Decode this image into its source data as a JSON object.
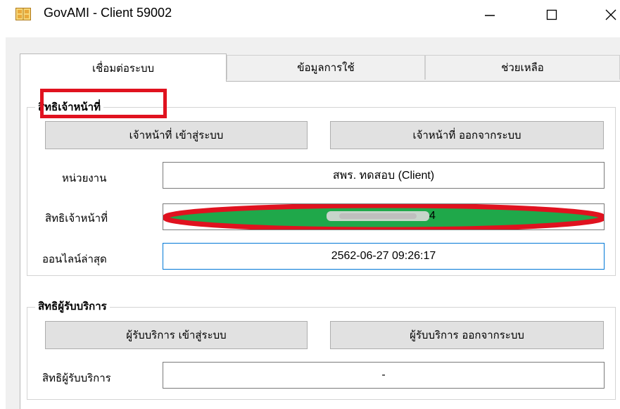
{
  "window": {
    "title": "GovAMI - Client 59002",
    "controls": {
      "minimize": "—",
      "maximize": "☐",
      "close": "✕"
    }
  },
  "tabs": [
    {
      "label": "เชื่อมต่อระบบ",
      "active": true
    },
    {
      "label": "ข้อมูลการใช้",
      "active": false
    },
    {
      "label": "ช่วยเหลือ",
      "active": false
    }
  ],
  "officer": {
    "group_title": "สิทธิเจ้าหน้าที่",
    "login_label": "เจ้าหน้าที่ เข้าสู่ระบบ",
    "logout_label": "เจ้าหน้าที่ ออกจากระบบ",
    "agency_label": "หน่วยงาน",
    "agency_value": "สพร. ทดสอบ (Client)",
    "rights_label": "สิทธิเจ้าหน้าที่",
    "rights_value_visible": "4",
    "last_online_label": "ออนไลน์ล่าสุด",
    "last_online_value": "2562-06-27 09:26:17"
  },
  "customer": {
    "group_title": "สิทธิผู้รับบริการ",
    "login_label": "ผู้รับบริการ เข้าสู่ระบบ",
    "logout_label": "ผู้รับบริการ ออกจากระบบ",
    "rights_label": "สิทธิผู้รับบริการ",
    "rights_value": "-"
  },
  "colors": {
    "annotation_red": "#e0121f",
    "highlight_green": "#1fa84a",
    "focus_border": "#0078d7"
  }
}
